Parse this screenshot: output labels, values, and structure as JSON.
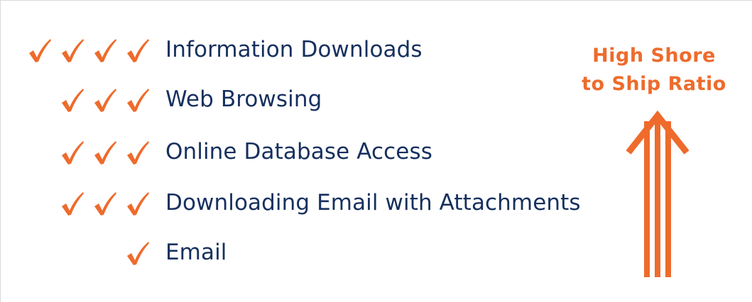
{
  "colors": {
    "accent": "#ee6b2c",
    "text": "#16305e"
  },
  "items": [
    {
      "label": "Information Downloads",
      "checks": 4
    },
    {
      "label": "Web Browsing",
      "checks": 3
    },
    {
      "label": "Online Database Access",
      "checks": 3
    },
    {
      "label": "Downloading Email with Attachments",
      "checks": 3
    },
    {
      "label": "Email",
      "checks": 1
    }
  ],
  "ratio": {
    "line1": "High Shore",
    "line2": "to Ship Ratio"
  },
  "icons": {
    "check": "checkmark-icon",
    "arrow": "up-arrow-icon"
  }
}
